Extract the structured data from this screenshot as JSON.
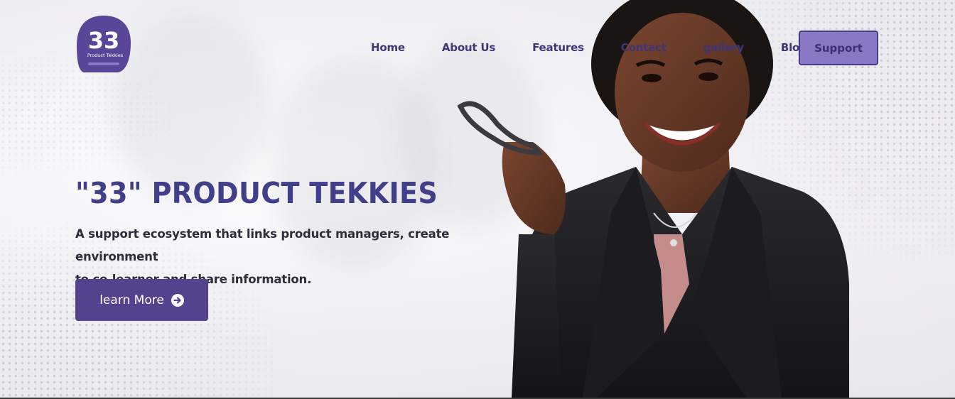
{
  "brand": {
    "logo_number": "33",
    "logo_tagline": "Product Tekkies",
    "colors": {
      "primary": "#54428f",
      "nav_text": "#3f3577",
      "title": "#413f8a",
      "support_bg": "#8878c4"
    }
  },
  "nav": {
    "items": [
      {
        "label": "Home"
      },
      {
        "label": "About Us"
      },
      {
        "label": "Features"
      },
      {
        "label": "Contact"
      },
      {
        "label": "gallery"
      },
      {
        "label": "Blog"
      }
    ],
    "support_label": "Support"
  },
  "hero": {
    "title": "\"33\" PRODUCT TEKKIES",
    "subtitle_line1": "A support ecosystem that links product managers, create environment",
    "subtitle_line2": "to co-learner and share information.",
    "cta_label": "learn More",
    "cta_icon": "arrow-right-circle-icon"
  }
}
